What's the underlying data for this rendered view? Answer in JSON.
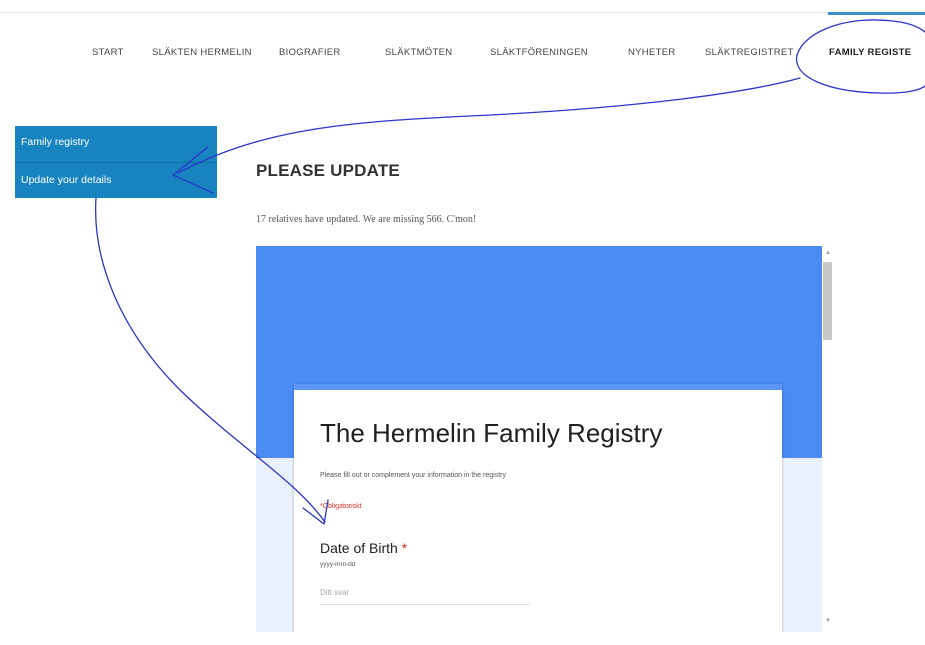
{
  "nav": {
    "items": [
      {
        "label": "START"
      },
      {
        "label": "SLÄKTEN HERMELIN"
      },
      {
        "label": "BIOGRAFIER"
      },
      {
        "label": "SLÄKTMÖTEN"
      },
      {
        "label": "SLÄKTFÖRENINGEN"
      },
      {
        "label": "NYHETER"
      },
      {
        "label": "SLÄKTREGISTRET"
      },
      {
        "label": "FAMILY REGISTE"
      }
    ],
    "active_index": 7
  },
  "sidebar": {
    "items": [
      {
        "label": "Family registry"
      },
      {
        "label": "Update your details"
      }
    ]
  },
  "page": {
    "title": "PLEASE UPDATE",
    "subtitle": "17 relatives have updated. We are missing 566. C'mon!"
  },
  "form": {
    "title": "The Hermelin Family Registry",
    "description": "Please fill out or complement your information in the registry",
    "required_note": "*Obligatoriskt",
    "question": {
      "title": "Date of Birth",
      "required_mark": "*",
      "hint": "yyyy-mm-dd",
      "placeholder": "Ditt svar"
    }
  },
  "colors": {
    "sidebar_bg": "#1784c0",
    "form_banner": "#4c8bf2",
    "form_page_bg": "#eaf1fc",
    "required_red": "#d93025",
    "annotation_ink": "#2a36c9"
  }
}
